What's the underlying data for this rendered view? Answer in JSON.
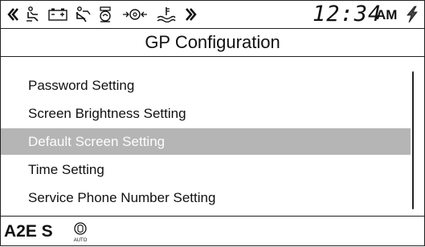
{
  "status_bar": {
    "icons": [
      "nav-left-icon",
      "operator-icon",
      "battery-icon",
      "seatbelt-icon",
      "engine-oil-icon",
      "transmission-icon",
      "coolant-icon",
      "nav-right-icon"
    ],
    "clock": "12:34",
    "ampm": "AM",
    "charging_icon": "lightning-icon"
  },
  "title": "GP Configuration",
  "menu": {
    "items": [
      {
        "label": "Password Setting",
        "selected": false
      },
      {
        "label": "Screen Brightness Setting",
        "selected": false
      },
      {
        "label": "Default Screen Setting",
        "selected": true
      },
      {
        "label": "Time Setting",
        "selected": false
      },
      {
        "label": "Service Phone Number Setting",
        "selected": false
      }
    ]
  },
  "footer": {
    "machine_label": "A2E S",
    "mode_icon": "auto-mode-icon",
    "mode_text": "AUTO"
  },
  "colors": {
    "selected_bg": "#b5b5b5",
    "selected_text": "#fdfdfd",
    "border": "#222222"
  }
}
